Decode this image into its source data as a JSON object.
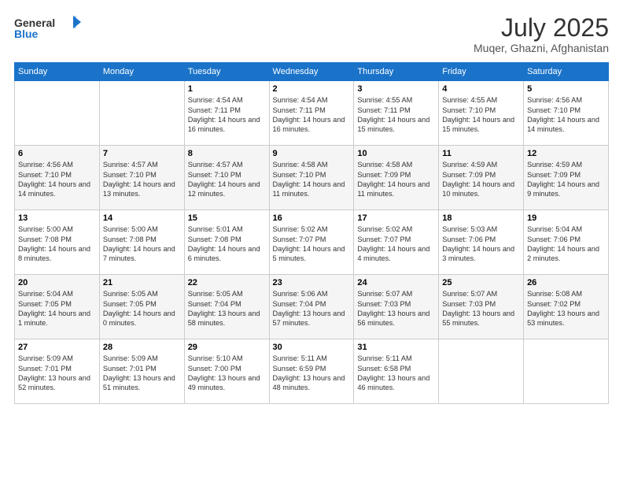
{
  "header": {
    "logo_line1": "General",
    "logo_line2": "Blue",
    "title": "July 2025",
    "subtitle": "Muqer, Ghazni, Afghanistan"
  },
  "weekdays": [
    "Sunday",
    "Monday",
    "Tuesday",
    "Wednesday",
    "Thursday",
    "Friday",
    "Saturday"
  ],
  "weeks": [
    [
      {
        "day": "",
        "info": ""
      },
      {
        "day": "",
        "info": ""
      },
      {
        "day": "1",
        "info": "Sunrise: 4:54 AM\nSunset: 7:11 PM\nDaylight: 14 hours and 16 minutes."
      },
      {
        "day": "2",
        "info": "Sunrise: 4:54 AM\nSunset: 7:11 PM\nDaylight: 14 hours and 16 minutes."
      },
      {
        "day": "3",
        "info": "Sunrise: 4:55 AM\nSunset: 7:11 PM\nDaylight: 14 hours and 15 minutes."
      },
      {
        "day": "4",
        "info": "Sunrise: 4:55 AM\nSunset: 7:10 PM\nDaylight: 14 hours and 15 minutes."
      },
      {
        "day": "5",
        "info": "Sunrise: 4:56 AM\nSunset: 7:10 PM\nDaylight: 14 hours and 14 minutes."
      }
    ],
    [
      {
        "day": "6",
        "info": "Sunrise: 4:56 AM\nSunset: 7:10 PM\nDaylight: 14 hours and 14 minutes."
      },
      {
        "day": "7",
        "info": "Sunrise: 4:57 AM\nSunset: 7:10 PM\nDaylight: 14 hours and 13 minutes."
      },
      {
        "day": "8",
        "info": "Sunrise: 4:57 AM\nSunset: 7:10 PM\nDaylight: 14 hours and 12 minutes."
      },
      {
        "day": "9",
        "info": "Sunrise: 4:58 AM\nSunset: 7:10 PM\nDaylight: 14 hours and 11 minutes."
      },
      {
        "day": "10",
        "info": "Sunrise: 4:58 AM\nSunset: 7:09 PM\nDaylight: 14 hours and 11 minutes."
      },
      {
        "day": "11",
        "info": "Sunrise: 4:59 AM\nSunset: 7:09 PM\nDaylight: 14 hours and 10 minutes."
      },
      {
        "day": "12",
        "info": "Sunrise: 4:59 AM\nSunset: 7:09 PM\nDaylight: 14 hours and 9 minutes."
      }
    ],
    [
      {
        "day": "13",
        "info": "Sunrise: 5:00 AM\nSunset: 7:08 PM\nDaylight: 14 hours and 8 minutes."
      },
      {
        "day": "14",
        "info": "Sunrise: 5:00 AM\nSunset: 7:08 PM\nDaylight: 14 hours and 7 minutes."
      },
      {
        "day": "15",
        "info": "Sunrise: 5:01 AM\nSunset: 7:08 PM\nDaylight: 14 hours and 6 minutes."
      },
      {
        "day": "16",
        "info": "Sunrise: 5:02 AM\nSunset: 7:07 PM\nDaylight: 14 hours and 5 minutes."
      },
      {
        "day": "17",
        "info": "Sunrise: 5:02 AM\nSunset: 7:07 PM\nDaylight: 14 hours and 4 minutes."
      },
      {
        "day": "18",
        "info": "Sunrise: 5:03 AM\nSunset: 7:06 PM\nDaylight: 14 hours and 3 minutes."
      },
      {
        "day": "19",
        "info": "Sunrise: 5:04 AM\nSunset: 7:06 PM\nDaylight: 14 hours and 2 minutes."
      }
    ],
    [
      {
        "day": "20",
        "info": "Sunrise: 5:04 AM\nSunset: 7:05 PM\nDaylight: 14 hours and 1 minute."
      },
      {
        "day": "21",
        "info": "Sunrise: 5:05 AM\nSunset: 7:05 PM\nDaylight: 14 hours and 0 minutes."
      },
      {
        "day": "22",
        "info": "Sunrise: 5:05 AM\nSunset: 7:04 PM\nDaylight: 13 hours and 58 minutes."
      },
      {
        "day": "23",
        "info": "Sunrise: 5:06 AM\nSunset: 7:04 PM\nDaylight: 13 hours and 57 minutes."
      },
      {
        "day": "24",
        "info": "Sunrise: 5:07 AM\nSunset: 7:03 PM\nDaylight: 13 hours and 56 minutes."
      },
      {
        "day": "25",
        "info": "Sunrise: 5:07 AM\nSunset: 7:03 PM\nDaylight: 13 hours and 55 minutes."
      },
      {
        "day": "26",
        "info": "Sunrise: 5:08 AM\nSunset: 7:02 PM\nDaylight: 13 hours and 53 minutes."
      }
    ],
    [
      {
        "day": "27",
        "info": "Sunrise: 5:09 AM\nSunset: 7:01 PM\nDaylight: 13 hours and 52 minutes."
      },
      {
        "day": "28",
        "info": "Sunrise: 5:09 AM\nSunset: 7:01 PM\nDaylight: 13 hours and 51 minutes."
      },
      {
        "day": "29",
        "info": "Sunrise: 5:10 AM\nSunset: 7:00 PM\nDaylight: 13 hours and 49 minutes."
      },
      {
        "day": "30",
        "info": "Sunrise: 5:11 AM\nSunset: 6:59 PM\nDaylight: 13 hours and 48 minutes."
      },
      {
        "day": "31",
        "info": "Sunrise: 5:11 AM\nSunset: 6:58 PM\nDaylight: 13 hours and 46 minutes."
      },
      {
        "day": "",
        "info": ""
      },
      {
        "day": "",
        "info": ""
      }
    ]
  ]
}
